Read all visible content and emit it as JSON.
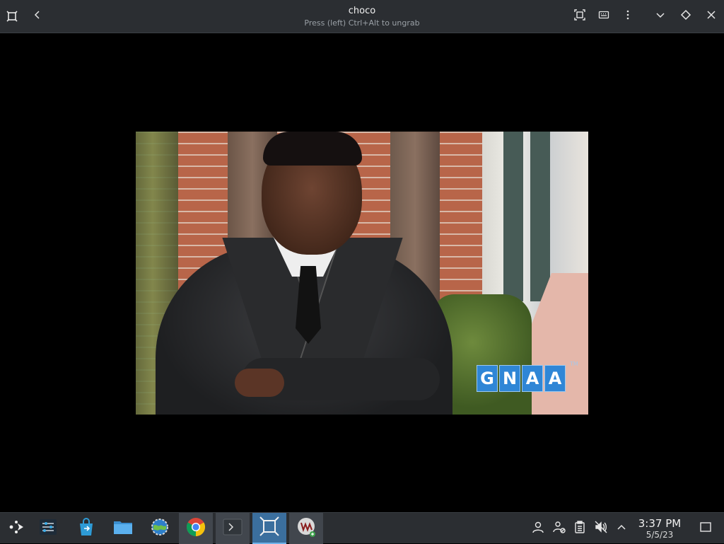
{
  "window": {
    "title": "choco",
    "subtitle": "Press (left) Ctrl+Alt to ungrab"
  },
  "titlebar_icons": {
    "app": "virt-manager-vm-icon",
    "back": "chevron-left-icon",
    "fullscreen": "fullscreen-icon",
    "keyboard": "keyboard-icon",
    "menu": "kebab-menu-icon",
    "minimize": "chevron-down-icon",
    "maximize": "diamond-icon",
    "close": "close-icon"
  },
  "vm_display": {
    "logo_letters": [
      "G",
      "N",
      "A",
      "A"
    ],
    "logo_tm": "TM",
    "colors": {
      "logo_blue": "#2f86d6"
    }
  },
  "taskbar": {
    "apps": [
      {
        "name": "app-launcher",
        "icon": "kde-launcher-icon"
      },
      {
        "name": "system-settings-mixer",
        "icon": "sliders-icon"
      },
      {
        "name": "discover",
        "icon": "store-bag-icon"
      },
      {
        "name": "dolphin",
        "icon": "folder-icon"
      },
      {
        "name": "browser-globe",
        "icon": "globe-settings-icon"
      },
      {
        "name": "chrome",
        "icon": "chrome-icon"
      },
      {
        "name": "konsole",
        "icon": "terminal-icon"
      },
      {
        "name": "virt-viewer",
        "icon": "vm-frame-icon"
      },
      {
        "name": "virt-manager",
        "icon": "vm-manager-icon"
      }
    ],
    "tray": {
      "user": "user-icon",
      "network": "network-icon",
      "clipboard": "clipboard-icon",
      "volume": "volume-muted-icon",
      "expand": "chevron-up-icon",
      "show_desktop": "show-desktop-icon"
    },
    "clock": {
      "time": "3:37 PM",
      "date": "5/5/23"
    }
  }
}
